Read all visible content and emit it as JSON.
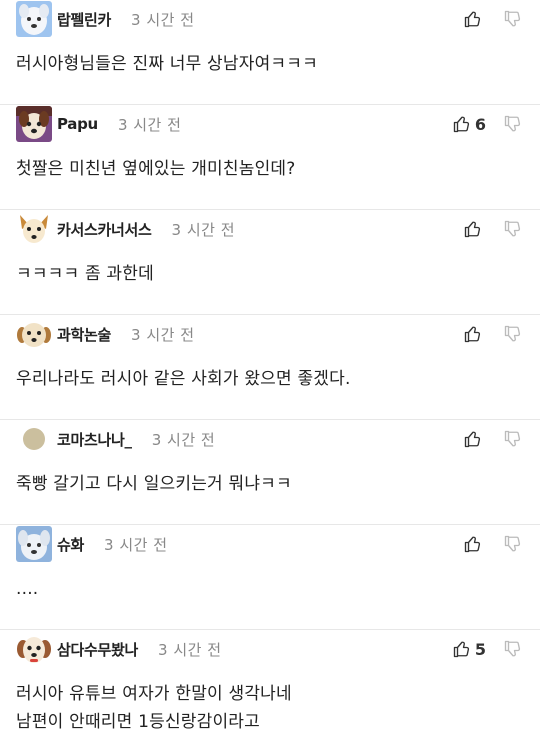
{
  "colors": {
    "text": "#222222",
    "time": "#888888",
    "divider": "#e7e7e7",
    "icon": "#333333",
    "icon_muted": "#bbbbbb"
  },
  "comments": [
    {
      "avatar_icon": "dog-face-icon",
      "nickname": "랍펠린카",
      "time": "3 시간 전",
      "like_count": "",
      "lines": [
        "러시아형님들은 진짜 너무 상남자여ㅋㅋㅋ"
      ]
    },
    {
      "avatar_icon": "dog-face-icon",
      "nickname": "Papu",
      "time": "3 시간 전",
      "like_count": "6",
      "lines": [
        "첫짤은 미친년 옆에있는 개미친놈인데?"
      ]
    },
    {
      "avatar_icon": "dog-face-icon",
      "nickname": "카서스카너서스",
      "time": "3 시간 전",
      "like_count": "",
      "lines": [
        "ㅋㅋㅋㅋ 좀 과한데"
      ]
    },
    {
      "avatar_icon": "dog-face-icon",
      "nickname": "과학논술",
      "time": "3 시간 전",
      "like_count": "",
      "lines": [
        "우리나라도 러시아 같은 사회가 왔으면 좋겠다."
      ]
    },
    {
      "avatar_icon": "circle-avatar-icon",
      "nickname": "코마츠나나_",
      "time": "3 시간 전",
      "like_count": "",
      "lines": [
        "죽빵 갈기고 다시 일으키는거 뭐냐ㅋㅋ"
      ]
    },
    {
      "avatar_icon": "dog-face-icon",
      "nickname": "슈화",
      "time": "3 시간 전",
      "like_count": "",
      "lines": [
        "...."
      ]
    },
    {
      "avatar_icon": "dog-face-icon",
      "nickname": "삼다수무봤나",
      "time": "3 시간 전",
      "like_count": "5",
      "lines": [
        "러시아 유튜브 여자가 한말이 생각나네",
        "남편이 안때리면 1등신랑감이라고"
      ]
    }
  ]
}
